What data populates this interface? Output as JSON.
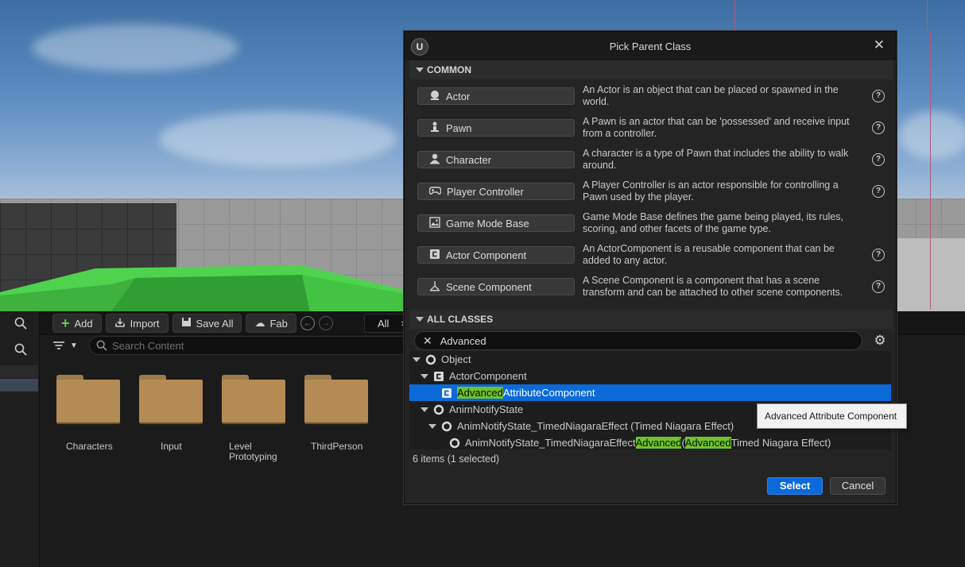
{
  "dialog": {
    "title": "Pick Parent Class",
    "common_header": "COMMON",
    "all_classes_header": "ALL CLASSES",
    "common_classes": [
      {
        "label": "Actor",
        "icon": "actor-icon",
        "description": "An Actor is an object that can be placed or spawned in the world."
      },
      {
        "label": "Pawn",
        "icon": "pawn-icon",
        "description": "A Pawn is an actor that can be 'possessed' and receive input from a controller."
      },
      {
        "label": "Character",
        "icon": "character-icon",
        "description": "A character is a type of Pawn that includes the ability to walk around."
      },
      {
        "label": "Player Controller",
        "icon": "gamepad-icon",
        "description": "A Player Controller is an actor responsible for controlling a Pawn used by the player."
      },
      {
        "label": "Game Mode Base",
        "icon": "game-mode-icon",
        "description": "Game Mode Base defines the game being played, its rules, scoring, and other facets of the game type."
      },
      {
        "label": "Actor Component",
        "icon": "component-icon",
        "description": "An ActorComponent is a reusable component that can be added to any actor."
      },
      {
        "label": "Scene Component",
        "icon": "scene-component-icon",
        "description": "A Scene Component is a component that has a scene transform and can be attached to other scene components."
      }
    ],
    "search_value": "Advanced",
    "tree": {
      "object": "Object",
      "actor_component": "ActorComponent",
      "adv_attr_hl": "Advanced",
      "adv_attr_rest": "AttributeComponent",
      "anim_notify_state": "AnimNotifyState",
      "timed_niagara": "AnimNotifyState_TimedNiagaraEffect (Timed Niagara Effect)",
      "timed_adv_prefix": "AnimNotifyState_TimedNiagaraEffect",
      "timed_adv_hl1": "Advanced",
      "timed_adv_mid": " (",
      "timed_adv_hl2": "Advanced",
      "timed_adv_suffix": " Timed Niagara Effect)"
    },
    "status": "6 items (1 selected)",
    "select_label": "Select",
    "cancel_label": "Cancel"
  },
  "tooltip": "Advanced Attribute Component",
  "content_browser": {
    "add_label": "Add",
    "import_label": "Import",
    "save_all_label": "Save All",
    "fab_label": "Fab",
    "all_tab": "All",
    "search_placeholder": "Search Content",
    "folders": [
      "Characters",
      "Input",
      "Level Prototyping",
      "ThirdPerson"
    ]
  },
  "colors": {
    "accent": "#0b6ad8",
    "highlight": "#6ec32a"
  }
}
